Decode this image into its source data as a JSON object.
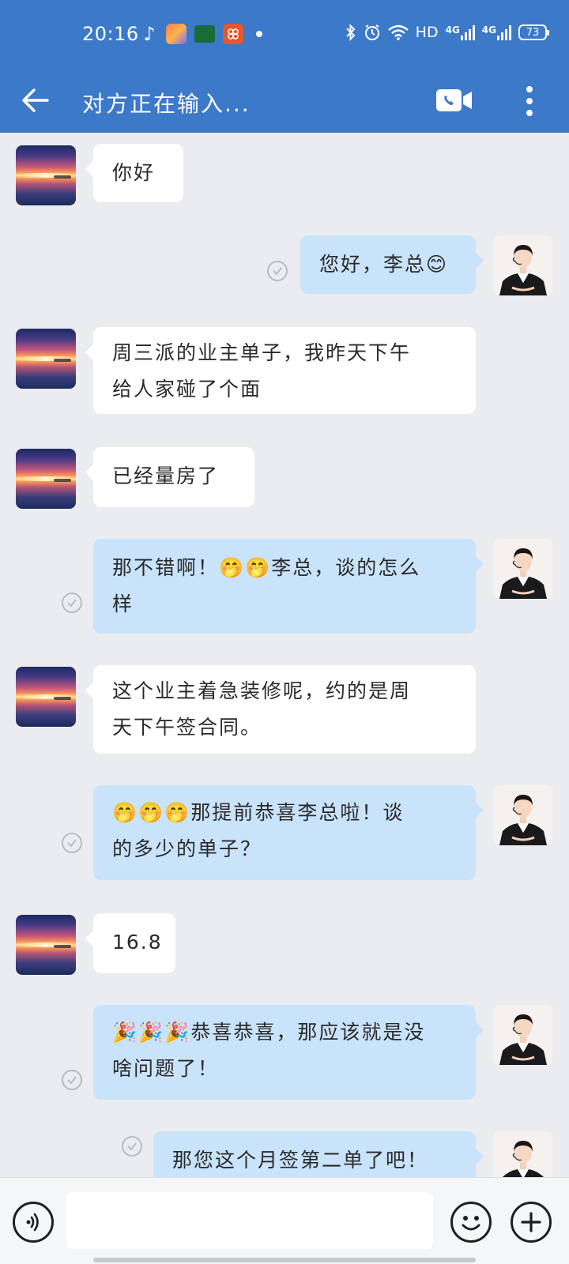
{
  "status_bar": {
    "time": "20:16",
    "network_label": "HD",
    "signal1_label": "4G",
    "signal2_label": "4G",
    "battery": "73",
    "icons": [
      "music-note-icon",
      "app-icon",
      "app-icon",
      "app-icon",
      "dot-icon",
      "bluetooth-icon",
      "alarm-icon",
      "wifi-icon"
    ]
  },
  "header": {
    "title": "对方正在输入...",
    "icons": [
      "back-arrow-icon",
      "video-call-icon",
      "more-vert-icon"
    ]
  },
  "messages": [
    {
      "side": "in",
      "lines": [
        "你好"
      ]
    },
    {
      "side": "out",
      "lines": [
        "您好，李总😊"
      ]
    },
    {
      "side": "in",
      "lines": [
        "周三派的业主单子，我昨天下午",
        "给人家碰了个面"
      ]
    },
    {
      "side": "in",
      "lines": [
        "已经量房了"
      ]
    },
    {
      "side": "out",
      "lines": [
        "那不错啊！🤭🤭李总，谈的怎么",
        "样"
      ]
    },
    {
      "side": "in",
      "lines": [
        "这个业主着急装修呢，约的是周",
        "天下午签合同。"
      ]
    },
    {
      "side": "out",
      "lines": [
        "🤭🤭🤭那提前恭喜李总啦！谈",
        "的多少的单子？"
      ]
    },
    {
      "side": "in",
      "lines": [
        "16.8"
      ]
    },
    {
      "side": "out",
      "lines": [
        "🎉🎉🎉恭喜恭喜，那应该就是没",
        "啥问题了！"
      ]
    },
    {
      "side": "out",
      "lines": [
        "那您这个月签第二单了吧！"
      ]
    }
  ],
  "input": {
    "placeholder": "",
    "icons": [
      "voice-icon",
      "emoji-icon",
      "plus-icon"
    ]
  },
  "colors": {
    "header_bg": "#3c79c9",
    "chat_bg": "#ebecef",
    "incoming_bubble": "#ffffff",
    "outgoing_bubble": "#c9e3fb"
  }
}
